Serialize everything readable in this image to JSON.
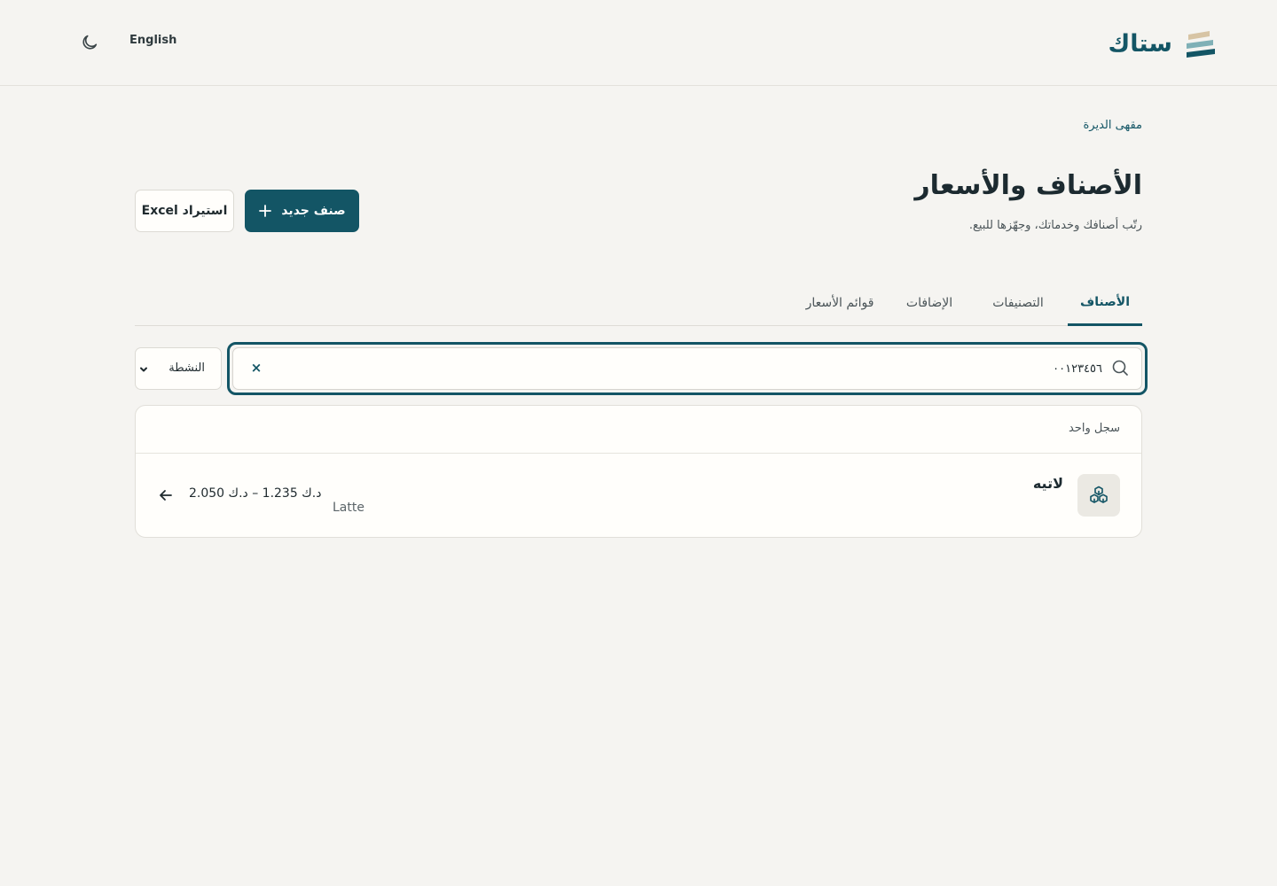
{
  "header": {
    "brand_name": "ستاك",
    "language_label": "English",
    "icons": {
      "logo": "stack-logo",
      "theme": "moon-icon"
    }
  },
  "page": {
    "breadcrumb": "مقهى الديرة",
    "title": "الأصناف والأسعار",
    "subtitle": "رتّب أصنافك وخدماتك، وجهّزها للبيع.",
    "new_item_label": "صنف جديد",
    "import_label": "استيراد Excel"
  },
  "tabs": [
    {
      "label": "الأصناف",
      "active": true
    },
    {
      "label": "التصنيفات",
      "active": false
    },
    {
      "label": "الإضافات",
      "active": false
    },
    {
      "label": "قوائم الأسعار",
      "active": false
    }
  ],
  "search": {
    "value": "٠٠١٢٣٤٥٦",
    "placeholder": "",
    "clear_label": "×"
  },
  "filter": {
    "status_selected": "النشطة"
  },
  "results": {
    "count_label": "سجل واحد",
    "items": [
      {
        "name": "لاتيه",
        "sku": "Latte",
        "price_range": "د.ك 1.235 – د.ك 2.050",
        "icon": "cubes-icon"
      }
    ]
  },
  "colors": {
    "accent": "#135565",
    "background": "#f5f4f1",
    "card": "#fffefb"
  }
}
